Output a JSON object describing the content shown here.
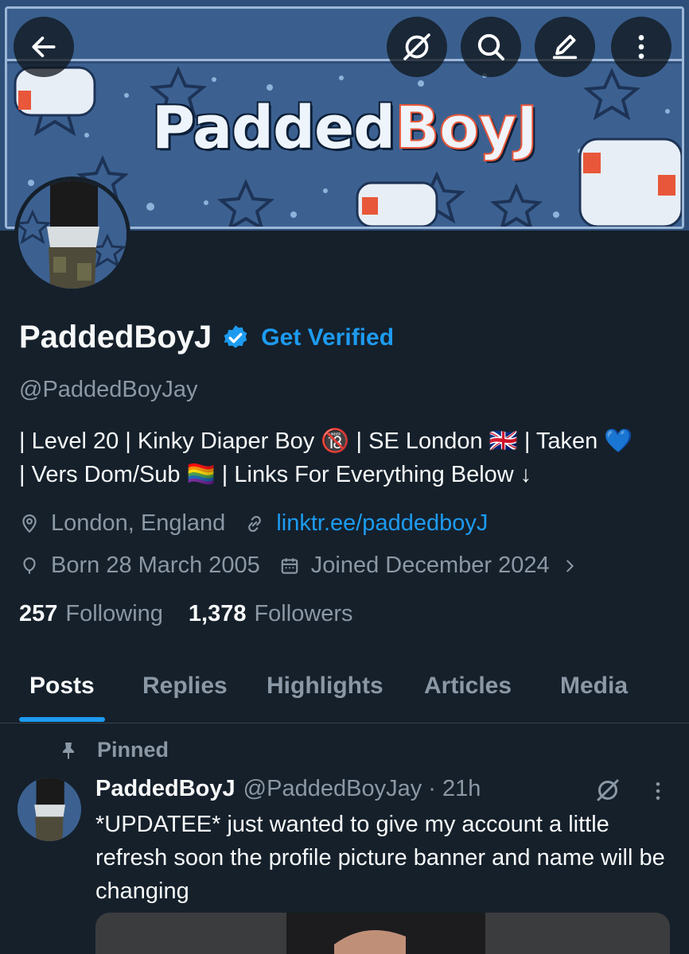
{
  "banner": {
    "title_part1": "Padded",
    "title_part2": "BoyJ"
  },
  "profile": {
    "display_name": "PaddedBoyJ",
    "get_verified_label": "Get Verified",
    "handle": "@PaddedBoyJay",
    "bio_line1": "| Level 20 | Kinky Diaper Boy 🔞 | SE London 🇬🇧 | Taken 💙",
    "bio_line2": "| Vers Dom/Sub 🏳️‍🌈 | Links For Everything Below ↓",
    "location": "London, England",
    "link": "linktr.ee/paddedboyJ",
    "birthday": "Born 28 March 2005",
    "joined": "Joined December 2024",
    "following_count": "257",
    "following_label": "Following",
    "followers_count": "1,378",
    "followers_label": "Followers"
  },
  "tabs": [
    {
      "label": "Posts"
    },
    {
      "label": "Replies"
    },
    {
      "label": "Highlights"
    },
    {
      "label": "Articles"
    },
    {
      "label": "Media"
    }
  ],
  "pinned_post": {
    "pinned_label": "Pinned",
    "author_name": "PaddedBoyJ",
    "author_handle_time": "@PaddedBoyJay · 21h",
    "text": "*UPDATEE* just wanted to give my account a little refresh soon the profile picture banner and name will be changing"
  },
  "colors": {
    "background": "#15202b",
    "accent": "#1d9bf0",
    "muted": "#8b98a5",
    "banner_red": "#e8573a"
  },
  "icons": [
    "back-arrow-icon",
    "grok-icon",
    "search-icon",
    "compose-icon",
    "more-vertical-icon",
    "verified-badge-icon",
    "location-pin-icon",
    "link-icon",
    "balloon-icon",
    "calendar-icon",
    "chevron-right-icon",
    "pin-icon",
    "more-vertical-icon"
  ]
}
